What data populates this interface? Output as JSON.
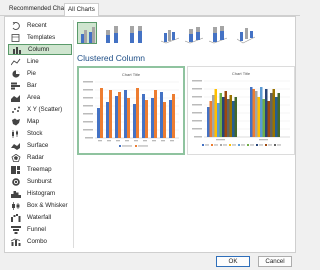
{
  "tabs": [
    {
      "label": "Recommended Charts"
    },
    {
      "label": "All Charts"
    }
  ],
  "sidebar": {
    "items": [
      {
        "label": "Recent",
        "icon": "recent-icon"
      },
      {
        "label": "Templates",
        "icon": "templates-icon"
      },
      {
        "label": "Column",
        "icon": "column-chart-icon",
        "selected": true
      },
      {
        "label": "Line",
        "icon": "line-chart-icon"
      },
      {
        "label": "Pie",
        "icon": "pie-chart-icon"
      },
      {
        "label": "Bar",
        "icon": "bar-chart-icon"
      },
      {
        "label": "Area",
        "icon": "area-chart-icon"
      },
      {
        "label": "X Y (Scatter)",
        "icon": "scatter-chart-icon"
      },
      {
        "label": "Map",
        "icon": "map-chart-icon"
      },
      {
        "label": "Stock",
        "icon": "stock-chart-icon"
      },
      {
        "label": "Surface",
        "icon": "surface-chart-icon"
      },
      {
        "label": "Radar",
        "icon": "radar-chart-icon"
      },
      {
        "label": "Treemap",
        "icon": "treemap-chart-icon"
      },
      {
        "label": "Sunburst",
        "icon": "sunburst-chart-icon"
      },
      {
        "label": "Histogram",
        "icon": "histogram-chart-icon"
      },
      {
        "label": "Box & Whisker",
        "icon": "box-whisker-chart-icon"
      },
      {
        "label": "Waterfall",
        "icon": "waterfall-chart-icon"
      },
      {
        "label": "Funnel",
        "icon": "funnel-chart-icon"
      },
      {
        "label": "Combo",
        "icon": "combo-chart-icon"
      }
    ]
  },
  "chart_types": [
    {
      "icon": "clustered-column-icon",
      "selected": true
    },
    {
      "icon": "stacked-column-icon"
    },
    {
      "icon": "100-stacked-column-icon"
    },
    {
      "icon": "3d-clustered-column-icon"
    },
    {
      "icon": "3d-stacked-column-icon"
    },
    {
      "icon": "3d-100-stacked-column-icon"
    },
    {
      "icon": "3d-column-icon"
    }
  ],
  "heading": "Clustered Column",
  "previews": [
    {
      "title": "Chart Title"
    },
    {
      "title": "Chart Title"
    }
  ],
  "colors": {
    "accent": "#5a9a6a",
    "selected_bg": "#cfe5cf",
    "heading": "#1f4f87",
    "series_blue": "#4472c4",
    "series_orange": "#ed7d31"
  },
  "buttons": {
    "ok": "OK",
    "cancel": "Cancel"
  }
}
